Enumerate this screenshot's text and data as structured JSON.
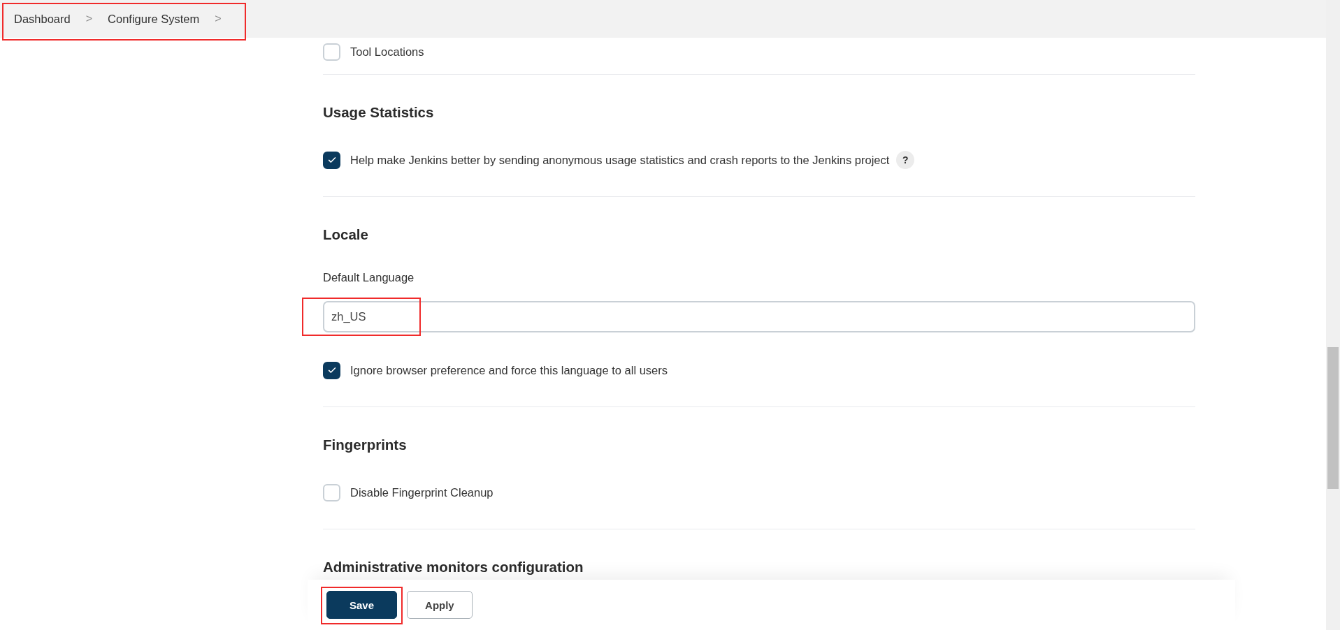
{
  "breadcrumbs": {
    "highlighted": true,
    "items": [
      {
        "label": "Dashboard",
        "separator": ">"
      },
      {
        "label": "Configure System",
        "separator": ">"
      }
    ]
  },
  "sections": [
    {
      "kind": "options",
      "options": [
        {
          "label": "Tool Locations",
          "checked": false
        }
      ]
    },
    {
      "kind": "options",
      "title": "Usage Statistics",
      "options": [
        {
          "label": "Help make Jenkins better by sending anonymous usage statistics and crash reports to the Jenkins project",
          "checked": true,
          "help": "?"
        }
      ]
    },
    {
      "kind": "locale",
      "title": "Locale",
      "field_label": "Default Language",
      "value": "zh_US",
      "highlighted": true,
      "options": [
        {
          "label": "Ignore browser preference and force this language to all users",
          "checked": true
        }
      ]
    },
    {
      "kind": "options",
      "title": "Fingerprints",
      "options": [
        {
          "label": "Disable Fingerprint Cleanup",
          "checked": false
        }
      ]
    },
    {
      "kind": "heading",
      "title": "Administrative monitors configuration"
    }
  ],
  "buttons": [
    {
      "label": "Save",
      "primary": true,
      "highlighted": true
    },
    {
      "label": "Apply",
      "primary": false,
      "highlighted": false
    }
  ]
}
